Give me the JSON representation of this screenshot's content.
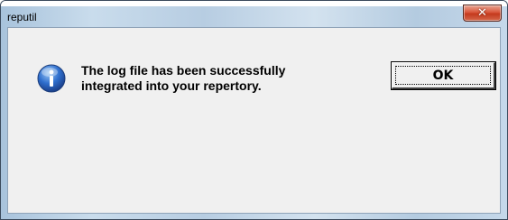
{
  "window": {
    "title": "reputil",
    "close_glyph": "✕",
    "frame_color": "#b7cde2",
    "close_color": "#c43a1d"
  },
  "dialog": {
    "icon": "info-icon",
    "message_lines": [
      "The log file has been successfully",
      "integrated into your repertory."
    ],
    "ok_label": "OK",
    "background": "#f0f0f0"
  }
}
